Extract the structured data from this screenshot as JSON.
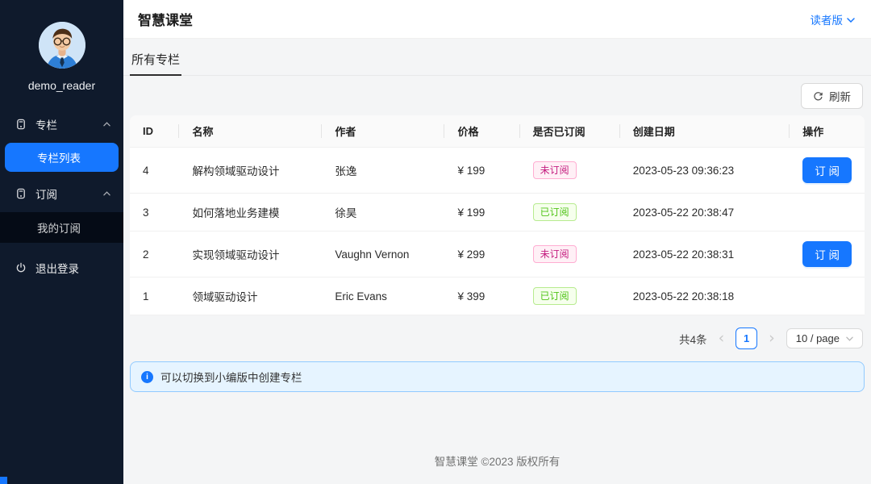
{
  "header": {
    "title": "智慧课堂",
    "version_label": "读者版"
  },
  "sidebar": {
    "username": "demo_reader",
    "menus": [
      {
        "label": "专栏",
        "icon": "container-icon",
        "expanded": true,
        "children": [
          {
            "label": "专栏列表",
            "active": true
          }
        ]
      },
      {
        "label": "订阅",
        "icon": "container-icon",
        "expanded": true,
        "children": [
          {
            "label": "我的订阅",
            "active": false
          }
        ]
      }
    ],
    "logout_label": "退出登录"
  },
  "tabs": [
    {
      "label": "所有专栏",
      "active": true
    }
  ],
  "toolbar": {
    "refresh_label": "刷新"
  },
  "table": {
    "columns": [
      "ID",
      "名称",
      "作者",
      "价格",
      "是否已订阅",
      "创建日期",
      "操作"
    ],
    "rows": [
      {
        "id": "4",
        "name": "解构领域驱动设计",
        "author": "张逸",
        "price": "¥ 199",
        "subscribed": false,
        "status_label": "未订阅",
        "created": "2023-05-23 09:36:23",
        "action_label": "订 阅"
      },
      {
        "id": "3",
        "name": "如何落地业务建模",
        "author": "徐昊",
        "price": "¥ 199",
        "subscribed": true,
        "status_label": "已订阅",
        "created": "2023-05-22 20:38:47",
        "action_label": null
      },
      {
        "id": "2",
        "name": "实现领域驱动设计",
        "author": "Vaughn Vernon",
        "price": "¥ 299",
        "subscribed": false,
        "status_label": "未订阅",
        "created": "2023-05-22 20:38:31",
        "action_label": "订 阅"
      },
      {
        "id": "1",
        "name": "领域驱动设计",
        "author": "Eric Evans",
        "price": "¥ 399",
        "subscribed": true,
        "status_label": "已订阅",
        "created": "2023-05-22 20:38:18",
        "action_label": null
      }
    ]
  },
  "pagination": {
    "total_label": "共4条",
    "current_page": "1",
    "page_size_label": "10 / page",
    "prev_glyph": "‹",
    "next_glyph": "›"
  },
  "alert": {
    "message": "可以切换到小编版中创建专栏",
    "info_glyph": "i"
  },
  "footer": {
    "copyright": "智慧课堂 ©2023 版权所有"
  },
  "icons": {
    "menu_group": "container-icon",
    "menu_caret": "chevron-up-icon",
    "logout": "power-icon",
    "refresh": "reload-icon",
    "version_caret": "chevron-down-icon",
    "page_size_caret": "chevron-down-icon",
    "alert": "info-circle-icon"
  },
  "colors": {
    "accent": "#1677ff",
    "sidebar_bg": "#0f1a2c",
    "submenu_bg": "#050b16",
    "tag_unsubscribed_text": "#c41d7f",
    "tag_unsubscribed_bg": "#fff0f6",
    "tag_unsubscribed_border": "#ffadd2",
    "tag_subscribed_text": "#52c41a",
    "tag_subscribed_bg": "#f6ffed",
    "tag_subscribed_border": "#b7eb8f",
    "alert_bg": "#e6f4ff",
    "alert_border": "#91caff",
    "table_header_bg": "#fafafa"
  }
}
